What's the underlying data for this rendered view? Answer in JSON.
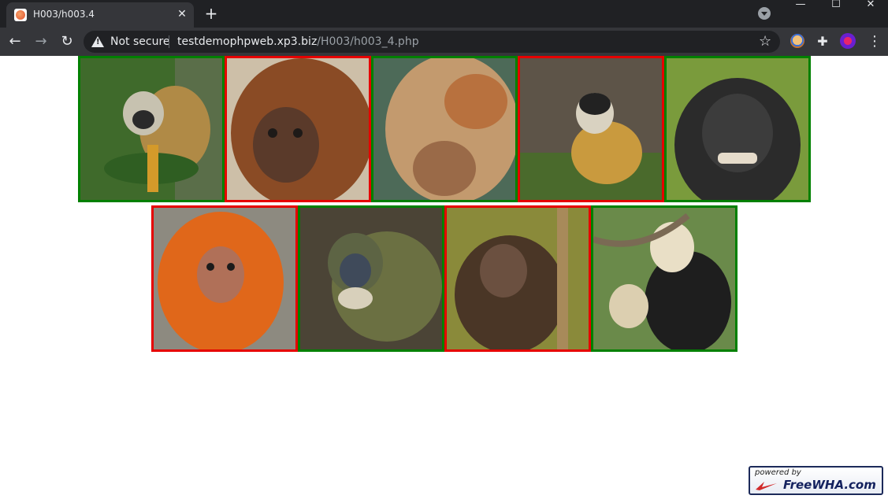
{
  "browser": {
    "tab_title": "H003/h003.4",
    "tab_close": "✕",
    "new_tab": "+",
    "security_label": "Not secure",
    "url_host": "testdemophpweb.xp3.biz",
    "url_path": "/H003/h003_4.php",
    "window_controls": [
      "—",
      "☐",
      "✕"
    ],
    "icons": [
      "back-arrow-icon",
      "forward-arrow-icon",
      "reload-icon",
      "warning-icon",
      "star-icon",
      "puzzle-icon",
      "profile-icon",
      "menu-dots-icon"
    ]
  },
  "gallery": {
    "rows": [
      [
        {
          "subject": "squirrel monkey",
          "selected": "correct",
          "border_color": "#008000"
        },
        {
          "subject": "howler monkey",
          "selected": "incorrect",
          "border_color": "#e60000"
        },
        {
          "subject": "proboscis monkey",
          "selected": "correct",
          "border_color": "#008000"
        },
        {
          "subject": "squirrel monkey",
          "selected": "incorrect",
          "border_color": "#e60000"
        },
        {
          "subject": "crested macaque",
          "selected": "correct",
          "border_color": "#008000"
        }
      ],
      [
        {
          "subject": "golden lion tamarin",
          "selected": "incorrect",
          "border_color": "#e60000"
        },
        {
          "subject": "blue monkey",
          "selected": "correct",
          "border_color": "#008000"
        },
        {
          "subject": "spider monkey",
          "selected": "incorrect",
          "border_color": "#e60000"
        },
        {
          "subject": "capuchin monkey",
          "selected": "correct",
          "border_color": "#008000"
        }
      ]
    ]
  },
  "badge": {
    "top_text": "powered by",
    "main_text": "FreeWHA.com"
  },
  "colors": {
    "chrome_dark": "#202124",
    "chrome_mid": "#35363a",
    "correct_border": "#008000",
    "incorrect_border": "#e60000"
  }
}
